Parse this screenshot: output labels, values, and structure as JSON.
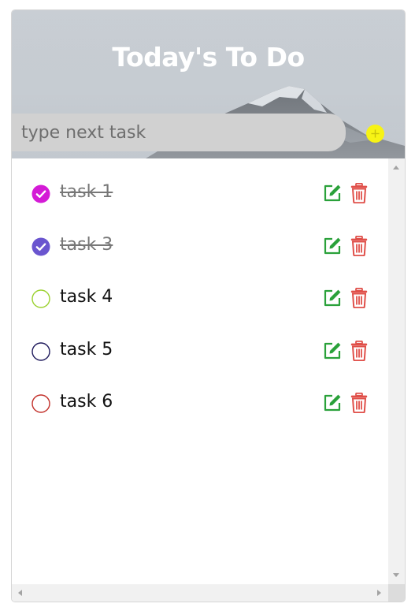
{
  "header": {
    "title": "Today's To Do"
  },
  "task_input": {
    "placeholder": "type next task",
    "value": ""
  },
  "add_button": {
    "icon": "plus-circle-icon",
    "color": "#f7f315"
  },
  "tasks": [
    {
      "label": "task 1",
      "done": true,
      "color": "#d41bd6"
    },
    {
      "label": "task 3",
      "done": true,
      "color": "#6a55cf"
    },
    {
      "label": "task 4",
      "done": false,
      "color": "#9ad12e"
    },
    {
      "label": "task 5",
      "done": false,
      "color": "#1f1a5c"
    },
    {
      "label": "task 6",
      "done": false,
      "color": "#c2302a"
    }
  ],
  "row_actions": {
    "edit_icon": "edit-icon",
    "edit_color": "#2aa13a",
    "delete_icon": "trash-icon",
    "delete_color": "#e0504a"
  }
}
